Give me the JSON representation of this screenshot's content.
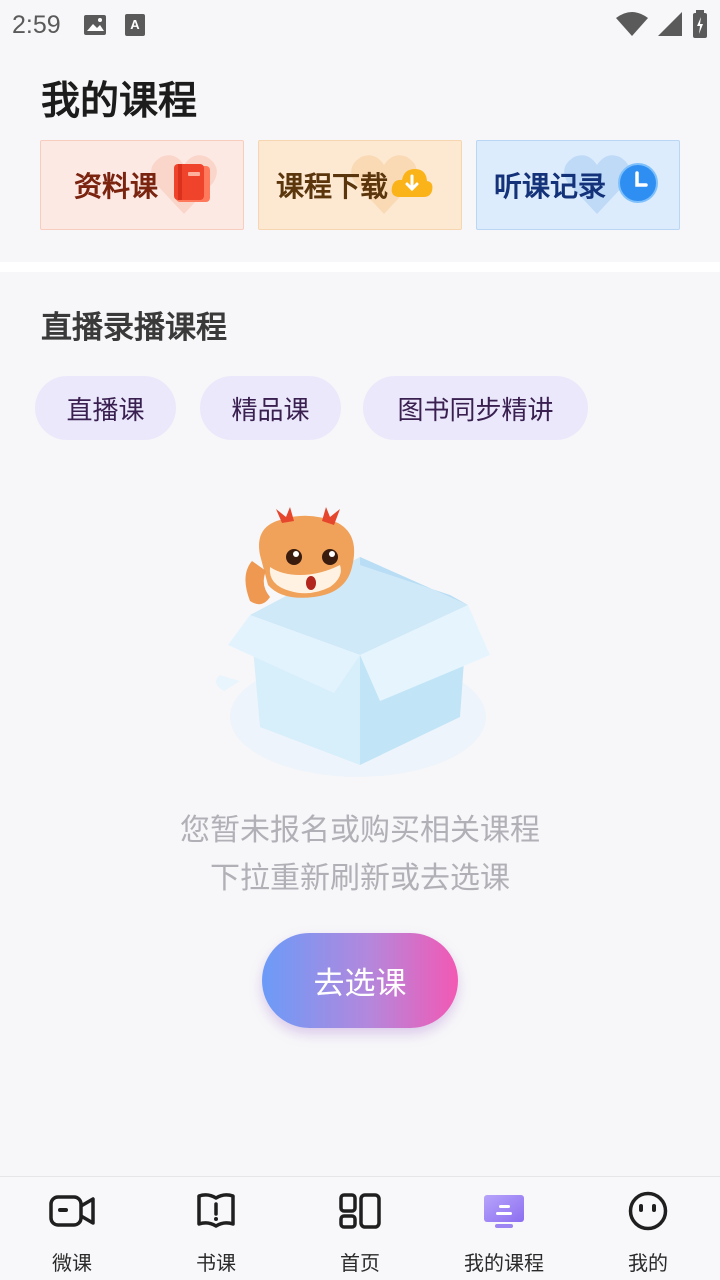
{
  "status_bar": {
    "time": "2:59",
    "icons": [
      "image-icon",
      "a-icon"
    ],
    "right_icons": [
      "wifi-icon",
      "signal-icon",
      "battery-icon"
    ]
  },
  "header": {
    "title": "我的课程"
  },
  "quick_cards": [
    {
      "label": "资料课",
      "icon": "book-icon",
      "color": "#7a2410"
    },
    {
      "label": "课程下载",
      "icon": "download-icon",
      "color": "#5b350b"
    },
    {
      "label": "听课记录",
      "icon": "clock-icon",
      "color": "#14327a"
    }
  ],
  "section": {
    "title": "直播录播课程",
    "chips": [
      "直播课",
      "精品课",
      "图书同步精讲"
    ]
  },
  "empty_state": {
    "line1": "您暂未报名或购买相关课程",
    "line2": "下拉重新刷新或去选课",
    "button": "去选课"
  },
  "bottom_nav": {
    "items": [
      {
        "label": "微课",
        "icon": "video-camera-icon"
      },
      {
        "label": "书课",
        "icon": "book-open-icon"
      },
      {
        "label": "首页",
        "icon": "home-grid-icon"
      },
      {
        "label": "我的课程",
        "icon": "monitor-icon",
        "active": true
      },
      {
        "label": "我的",
        "icon": "smiley-icon"
      }
    ]
  },
  "colors": {
    "accent_gradient_start": "#6b9bf8",
    "accent_gradient_end": "#f259b4",
    "active_nav": "#9a86f2"
  }
}
